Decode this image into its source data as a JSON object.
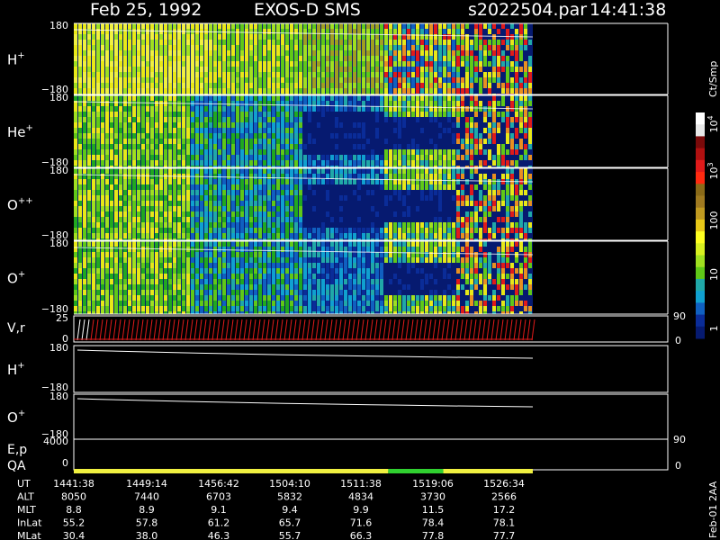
{
  "header": {
    "date": "Feb 25, 1992",
    "mission": "EXOS-D SMS",
    "file": "s2022504.par",
    "time": "14:41:38"
  },
  "panels": [
    {
      "label": "H",
      "sup": "+",
      "top": "180",
      "bottom": "−180"
    },
    {
      "label": "He",
      "sup": "+",
      "top": "180",
      "bottom": "−180"
    },
    {
      "label": "O",
      "sup": "++",
      "top": "180",
      "bottom": "−180"
    },
    {
      "label": "O",
      "sup": "+",
      "top": "180",
      "bottom": "−180"
    }
  ],
  "vr_panel": {
    "label": "V,r",
    "top": "25",
    "bottom": "0",
    "right_top": "90",
    "right_bottom": "0"
  },
  "pitch_panels": [
    {
      "label": "H",
      "sup": "+",
      "top": "180",
      "bottom": "−180"
    },
    {
      "label": "O",
      "sup": "+",
      "top": "180",
      "bottom": "−180"
    }
  ],
  "ep_panel": {
    "label1": "E,p",
    "label2": "QA",
    "top": "4000",
    "bottom": "0",
    "right_top": "90",
    "right_bottom": "0"
  },
  "colorbar": {
    "unit": "Ct/Smp",
    "ticks": [
      "10",
      "10",
      "100",
      "10",
      "1"
    ],
    "tick_sups": [
      "4",
      "3",
      "",
      "",
      ""
    ],
    "colors": [
      "#ffffff",
      "#e8e8e8",
      "#7a0a0a",
      "#b01010",
      "#e01a1a",
      "#ff2a10",
      "#8a6a18",
      "#a07a20",
      "#c09a20",
      "#e8c818",
      "#ffff20",
      "#d8f020",
      "#a0e020",
      "#60c818",
      "#20a8a8",
      "#10a0d0",
      "#1060c0",
      "#0a2c98",
      "#061a70"
    ]
  },
  "qa_bar": [
    {
      "from": 0.0,
      "to": 0.685,
      "color": "#f0f040"
    },
    {
      "from": 0.685,
      "to": 0.805,
      "color": "#30d030"
    },
    {
      "from": 0.805,
      "to": 1.0,
      "color": "#f0f040"
    }
  ],
  "ephemeris": {
    "row_labels": [
      "UT",
      "ALT",
      "MLT",
      "InLat",
      "MLat"
    ],
    "columns": [
      {
        "UT": "1441:38",
        "ALT": "8050",
        "MLT": "8.8",
        "InLat": "55.2",
        "MLat": "30.4"
      },
      {
        "UT": "1449:14",
        "ALT": "7440",
        "MLT": "8.9",
        "InLat": "57.8",
        "MLat": "38.0"
      },
      {
        "UT": "1456:42",
        "ALT": "6703",
        "MLT": "9.1",
        "InLat": "61.2",
        "MLat": "46.3"
      },
      {
        "UT": "1504:10",
        "ALT": "5832",
        "MLT": "9.4",
        "InLat": "65.7",
        "MLat": "55.7"
      },
      {
        "UT": "1511:38",
        "ALT": "4834",
        "MLT": "9.9",
        "InLat": "71.6",
        "MLat": "66.3"
      },
      {
        "UT": "1519:06",
        "ALT": "3730",
        "MLT": "11.5",
        "InLat": "78.4",
        "MLat": "77.8"
      },
      {
        "UT": "1526:34",
        "ALT": "2566",
        "MLT": "17.2",
        "InLat": "78.1",
        "MLat": "77.7"
      }
    ]
  },
  "footer": {
    "code": "Feb-01 2AA"
  },
  "chart_data": {
    "type": "heatmap",
    "title": "Feb 25, 1992   EXOS-D SMS",
    "subtitle": "s2022504.par  14:41:38",
    "x_ticks_UT": [
      "1441:38",
      "1449:14",
      "1456:42",
      "1504:10",
      "1511:38",
      "1519:06",
      "1526:34"
    ],
    "panels": [
      "H+",
      "He+",
      "O++",
      "O+"
    ],
    "ylim": [
      -180,
      180
    ],
    "colorbar": {
      "label": "Ct/Smp",
      "log": true,
      "range": [
        1,
        10000
      ]
    }
  }
}
